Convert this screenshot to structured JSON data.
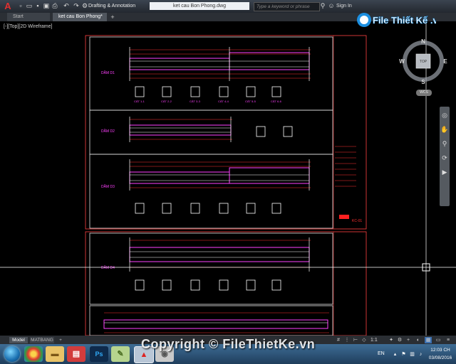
{
  "titlebar": {
    "workspace": "Drafting & Annotation",
    "document_title": "ket cau Bon Phong.dwg",
    "search_placeholder": "Type a keyword or phrase",
    "sign_in": "Sign In"
  },
  "doc_tabs": {
    "start": "Start",
    "current": "ket cau Bon Phong*",
    "plus": "+"
  },
  "viewport": {
    "label": "[-][Top][2D Wireframe]"
  },
  "viewcube": {
    "north": "N",
    "south": "S",
    "east": "E",
    "west": "W",
    "face": "TOP",
    "wcs": "WCS"
  },
  "drawing": {
    "beam_sections": [
      "DẦM D1",
      "DẦM D2",
      "DẦM D3",
      "DẦM D4"
    ],
    "cut_labels": [
      "CẮT 1-1",
      "CẮT 2-2",
      "CẮT 3-3",
      "CẮT 4-4",
      "CẮT 5-5",
      "CẮT 6-6"
    ],
    "title_block_code": "KC-01",
    "colors": {
      "frame": "#ff4040",
      "panel": "#ffffff",
      "beam": "#ff40ff",
      "dimension": "#ff3030",
      "text": "#ffffff",
      "crosshair": "#ffffff"
    }
  },
  "layout_tabs": {
    "model": "Model",
    "matbang": "MATBANG",
    "plus": "+"
  },
  "statusbar": {
    "scale": "1:1"
  },
  "taskbar": {
    "language": "EN",
    "time": "12:03 CH",
    "date": "03/08/2016"
  },
  "watermark": {
    "logo": "File Thiết Kế .vn",
    "copyright": "Copyright © FileThietKe.vn"
  }
}
